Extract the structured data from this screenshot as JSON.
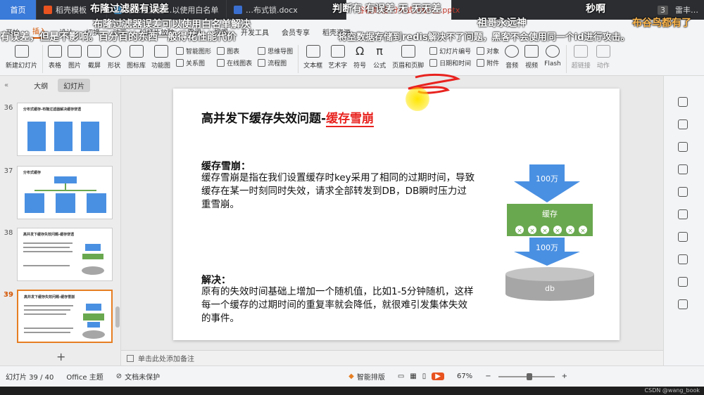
{
  "tabs": {
    "home": "首页",
    "items": [
      {
        "label": "稻壳模板",
        "color": "#e8531f"
      },
      {
        "label": "布…过滤器…以使用白名单解决",
        "color": "#4aa3df"
      },
      {
        "label": "…布式锁.docx",
        "color": "#3b6fcf"
      },
      {
        "label": "谷粒商城-分布式高级-图.pptx",
        "color": "#e8531f"
      }
    ],
    "right_badge": "3",
    "user": "雷丰…"
  },
  "menu": {
    "items": [
      "开始",
      "插入",
      "设计",
      "切换",
      "动画",
      "幻灯片放映",
      "审阅",
      "视图",
      "开发工具",
      "会员专享",
      "稻壳资源"
    ],
    "active_index": 1
  },
  "ribbon": {
    "new_slide": "新建幻灯片",
    "table": "表格",
    "picture": "图片",
    "screenshot": "截屏",
    "shape": "形状",
    "icon_lib": "图标库",
    "func_chart": "功能图",
    "smart_shape": "智能图形",
    "chart": "图表",
    "mindmap": "思维导图",
    "relation": "关系图",
    "online_chart": "在线图表",
    "flowchart": "流程图",
    "textbox": "文本框",
    "wordart": "艺术字",
    "symbol": "符号",
    "formula": "公式",
    "header_footer": "页眉和页脚",
    "slide_number": "幻灯片编号",
    "object": "对象",
    "datetime": "日期和时间",
    "attachment": "附件",
    "audio": "音频",
    "video": "视频",
    "flash": "Flash",
    "hyperlink": "超链接",
    "action": "动作"
  },
  "left_panel": {
    "tab_outline": "大纲",
    "tab_slides": "幻灯片",
    "thumbs": [
      {
        "num": "36",
        "title": "分布式缓存-布隆过滤器解决缓存穿透"
      },
      {
        "num": "37",
        "title": "分布式缓存"
      },
      {
        "num": "38",
        "title": "高并发下缓存失效问题-缓存穿透"
      },
      {
        "num": "39",
        "title": "高并发下缓存失效问题-缓存雪崩"
      }
    ]
  },
  "slide": {
    "title_prefix": "高并发下缓存失效问题-",
    "title_highlight": "缓存雪崩",
    "section1_heading": "缓存雪崩：",
    "section1_body": "缓存雪崩是指在我们设置缓存时key采用了相同的过期时间，导致缓存在某一时刻同时失效，请求全部转发到DB，DB瞬时压力过重雪崩。",
    "section2_heading": "解决：",
    "section2_body": "原有的失效时间基础上增加一个随机值，比如1-5分钟随机，这样每一个缓存的过期时间的重复率就会降低，就很难引发集体失效的事件。",
    "diagram": {
      "arrow_top": "100万",
      "cache_label": "缓存",
      "arrow_mid": "100万",
      "db_label": "db",
      "cache_color": "#6aa84f",
      "arrow_color": "#4a90e2",
      "db_color": "#a6a6a6"
    }
  },
  "notes_placeholder": "单击此处添加备注",
  "status": {
    "slide_count": "幻灯片 39 / 40",
    "theme": "Office 主题",
    "protect": "文档未保护",
    "smart_layout": "智能排版",
    "zoom": "67%"
  },
  "watermark": "CSDN @wang_book",
  "danmaku": [
    {
      "text": "布隆过滤器有误差",
      "color": "#ffffff"
    },
    {
      "text": "判断有  有误差  无  无无差",
      "color": "#ffffff"
    },
    {
      "text": "秒啊",
      "color": "#ffffff"
    },
    {
      "text": "祖哥永远神",
      "color": "#ffffff"
    },
    {
      "text": "布谷鸟都有了",
      "color": "#ffb84d"
    },
    {
      "text": "布隆过滤器误差可以使用白名单解决",
      "color": "#ffffff"
    },
    {
      "text": "有误差，但是不影响。百分百的东西一般得花性能代价",
      "color": "#ffffff"
    },
    {
      "text": "将空数据存储到redis解决不了问题，黑客不会使用同一个id进行攻击。",
      "color": "#ffffff"
    }
  ]
}
